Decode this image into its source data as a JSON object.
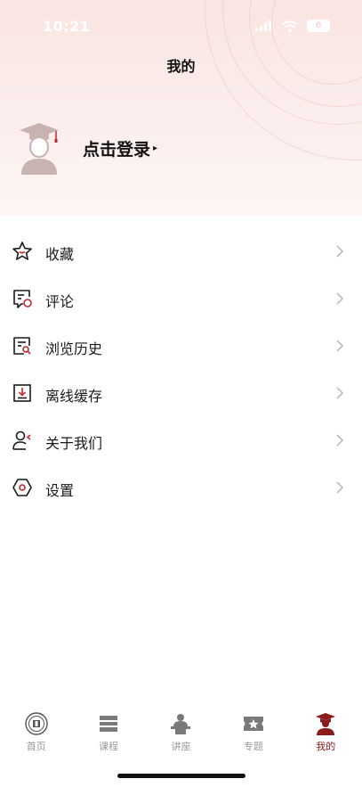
{
  "status_bar": {
    "time": "10:21",
    "battery": "6"
  },
  "header": {
    "title": "我的"
  },
  "login": {
    "label": "点击登录",
    "arrow": "▸"
  },
  "menu": {
    "items": [
      {
        "label": "收藏",
        "icon": "star-icon"
      },
      {
        "label": "评论",
        "icon": "comment-icon"
      },
      {
        "label": "浏览历史",
        "icon": "history-icon"
      },
      {
        "label": "离线缓存",
        "icon": "download-icon"
      },
      {
        "label": "关于我们",
        "icon": "about-icon"
      },
      {
        "label": "设置",
        "icon": "settings-icon"
      }
    ]
  },
  "tabbar": {
    "items": [
      {
        "label": "首页",
        "icon": "university-seal-icon",
        "active": false
      },
      {
        "label": "课程",
        "icon": "course-icon",
        "active": false
      },
      {
        "label": "讲座",
        "icon": "lecture-icon",
        "active": false
      },
      {
        "label": "专题",
        "icon": "topic-icon",
        "active": false
      },
      {
        "label": "我的",
        "icon": "profile-icon",
        "active": true
      }
    ]
  },
  "colors": {
    "accent": "#8b1c1c",
    "icon_stroke": "#1a1a1a",
    "icon_red": "#c0272d",
    "inactive": "#9a9a9a",
    "header_bg": "#f9e5e2"
  }
}
